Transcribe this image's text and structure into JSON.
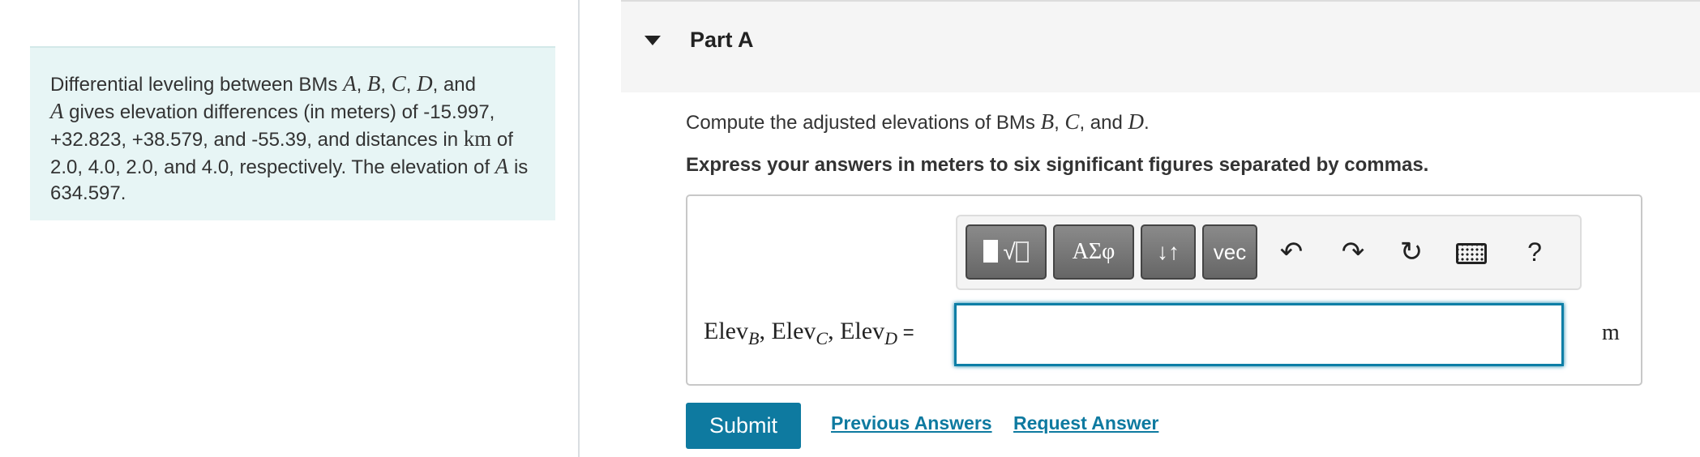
{
  "problem": {
    "t1": "Differential leveling between BMs ",
    "m1": "A",
    "s1": ", ",
    "m2": "B",
    "s2": ", ",
    "m3": "C",
    "s3": ", ",
    "m4": "D",
    "s4": ", and",
    "m5": "A",
    "t2": " gives elevation differences (in meters) of -15.997, +32.823, +38.579, and -55.39, and distances in ",
    "unit_km": "km",
    "t3": " of 2.0, 4.0, 2.0, and 4.0, respectively. The elevation of ",
    "m6": "A",
    "t4": " is 634.597."
  },
  "part": {
    "title": "Part A"
  },
  "question": {
    "t1": "Compute the adjusted elevations of BMs ",
    "m1": "B",
    "s1": ", ",
    "m2": "C",
    "s2": ", and ",
    "m3": "D",
    "end": "."
  },
  "instruction": "Express your answers in meters to six significant figures separated by commas.",
  "toolbar": {
    "greek_label": "ΑΣφ",
    "updown_label": "↓↑",
    "vec_label": "vec",
    "help_label": "?"
  },
  "answer": {
    "var1": "Elev",
    "sub1": "B",
    "sep1": ", ",
    "var2": "Elev",
    "sub2": "C",
    "sep2": ", ",
    "var3": "Elev",
    "sub3": "D",
    "equals": " =",
    "value": "",
    "unit": "m"
  },
  "actions": {
    "submit": "Submit",
    "previous_answers": "Previous Answers",
    "request_answer": "Request Answer"
  },
  "colors": {
    "accent": "#0e7aa0",
    "problem_bg": "#e7f5f5",
    "header_bg": "#f5f5f5"
  }
}
